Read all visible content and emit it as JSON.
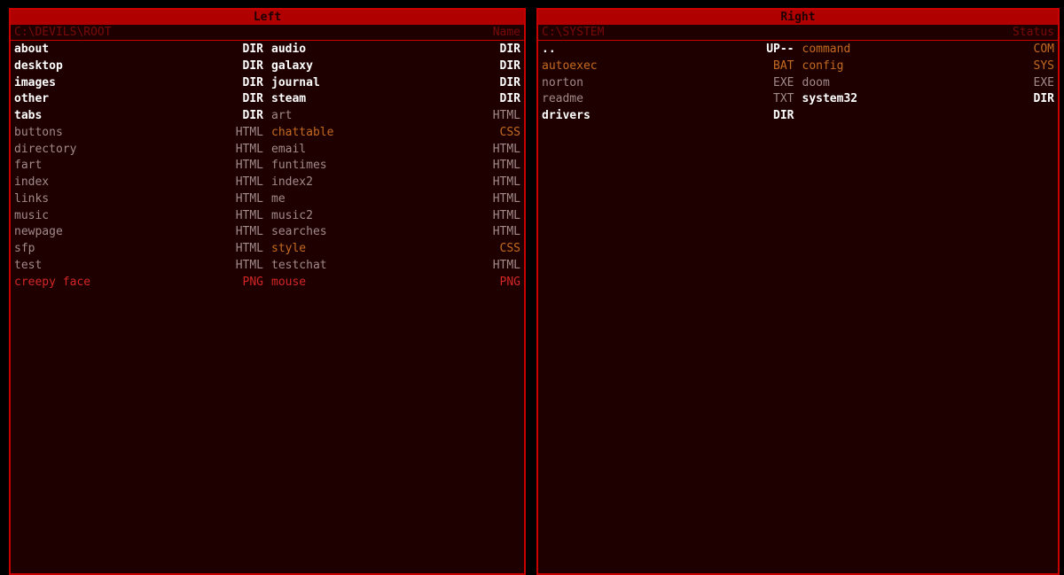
{
  "colors": {
    "background": "#1e0000",
    "border": "#c80000",
    "title_bar": "#b00000",
    "directory": "#ffffff",
    "document": "#a08a8a",
    "style_or_system": "#c46a22",
    "image": "#d42626"
  },
  "left_panel": {
    "title": "Left",
    "path": "C:\\DEVILS\\ROOT",
    "column_label": "Name",
    "columns": [
      [
        {
          "name": "about",
          "type": "DIR",
          "kind": "dir"
        },
        {
          "name": "desktop",
          "type": "DIR",
          "kind": "dir"
        },
        {
          "name": "images",
          "type": "DIR",
          "kind": "dir"
        },
        {
          "name": "other",
          "type": "DIR",
          "kind": "dir"
        },
        {
          "name": "tabs",
          "type": "DIR",
          "kind": "dir"
        },
        {
          "name": "buttons",
          "type": "HTML",
          "kind": "html"
        },
        {
          "name": "directory",
          "type": "HTML",
          "kind": "html"
        },
        {
          "name": "fart",
          "type": "HTML",
          "kind": "html"
        },
        {
          "name": "index",
          "type": "HTML",
          "kind": "html"
        },
        {
          "name": "links",
          "type": "HTML",
          "kind": "html"
        },
        {
          "name": "music",
          "type": "HTML",
          "kind": "html"
        },
        {
          "name": "newpage",
          "type": "HTML",
          "kind": "html"
        },
        {
          "name": "sfp",
          "type": "HTML",
          "kind": "html"
        },
        {
          "name": "test",
          "type": "HTML",
          "kind": "html"
        },
        {
          "name": "creepy face",
          "type": "PNG",
          "kind": "png"
        }
      ],
      [
        {
          "name": "audio",
          "type": "DIR",
          "kind": "dir"
        },
        {
          "name": "galaxy",
          "type": "DIR",
          "kind": "dir"
        },
        {
          "name": "journal",
          "type": "DIR",
          "kind": "dir"
        },
        {
          "name": "steam",
          "type": "DIR",
          "kind": "dir"
        },
        {
          "name": "art",
          "type": "HTML",
          "kind": "html"
        },
        {
          "name": "chattable",
          "type": "CSS",
          "kind": "css"
        },
        {
          "name": "email",
          "type": "HTML",
          "kind": "html"
        },
        {
          "name": "funtimes",
          "type": "HTML",
          "kind": "html"
        },
        {
          "name": "index2",
          "type": "HTML",
          "kind": "html"
        },
        {
          "name": "me",
          "type": "HTML",
          "kind": "html"
        },
        {
          "name": "music2",
          "type": "HTML",
          "kind": "html"
        },
        {
          "name": "searches",
          "type": "HTML",
          "kind": "html"
        },
        {
          "name": "style",
          "type": "CSS",
          "kind": "css"
        },
        {
          "name": "testchat",
          "type": "HTML",
          "kind": "html"
        },
        {
          "name": "mouse",
          "type": "PNG",
          "kind": "png"
        }
      ]
    ]
  },
  "right_panel": {
    "title": "Right",
    "path": "C:\\SYSTEM",
    "column_label": "Status",
    "columns": [
      [
        {
          "name": "..",
          "type": "UP--",
          "kind": "up"
        },
        {
          "name": "autoexec",
          "type": "BAT",
          "kind": "bat"
        },
        {
          "name": "norton",
          "type": "EXE",
          "kind": "exe"
        },
        {
          "name": "readme",
          "type": "TXT",
          "kind": "txt"
        },
        {
          "name": "drivers",
          "type": "DIR",
          "kind": "dir"
        }
      ],
      [
        {
          "name": "command",
          "type": "COM",
          "kind": "com"
        },
        {
          "name": "config",
          "type": "SYS",
          "kind": "sys"
        },
        {
          "name": "doom",
          "type": "EXE",
          "kind": "exe"
        },
        {
          "name": "system32",
          "type": "DIR",
          "kind": "dir"
        }
      ]
    ]
  }
}
